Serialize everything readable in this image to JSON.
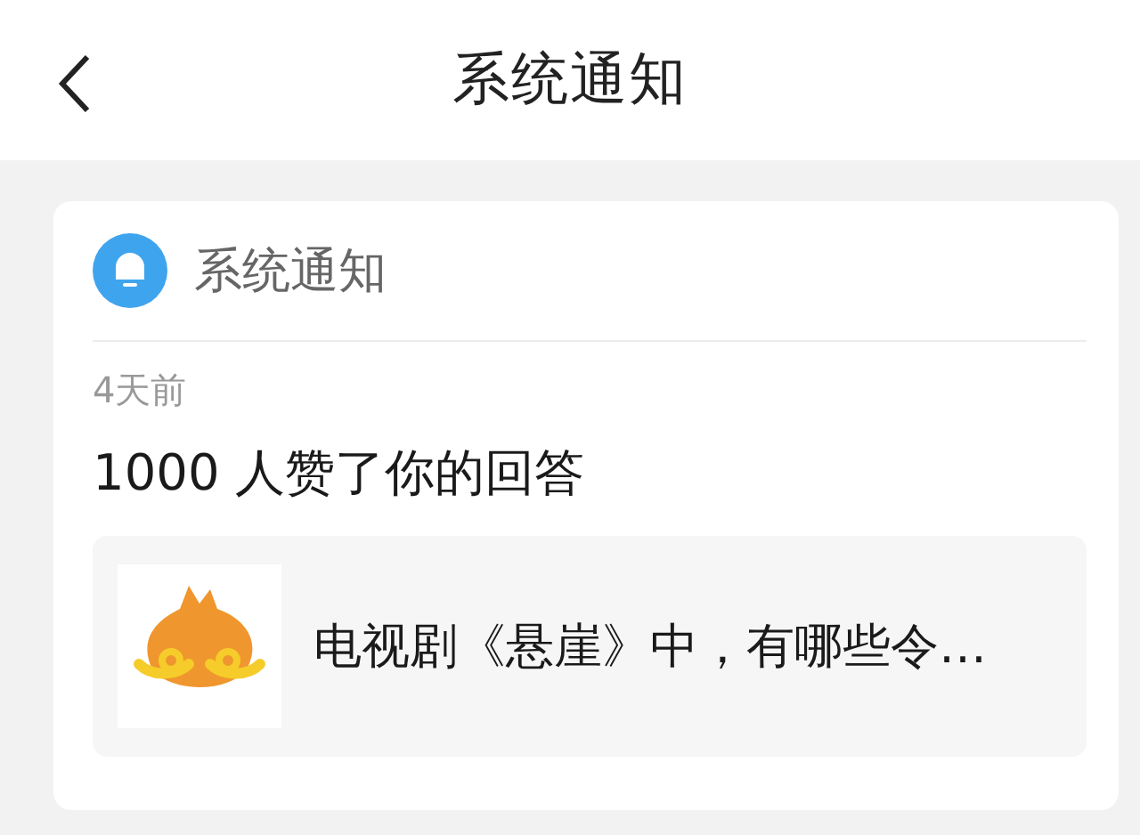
{
  "header": {
    "title": "系统通知"
  },
  "card": {
    "source": "系统通知",
    "time": "4天前",
    "message": "1000 人赞了你的回答",
    "quote": {
      "text": "电视剧《悬崖》中，有哪些令…"
    }
  }
}
